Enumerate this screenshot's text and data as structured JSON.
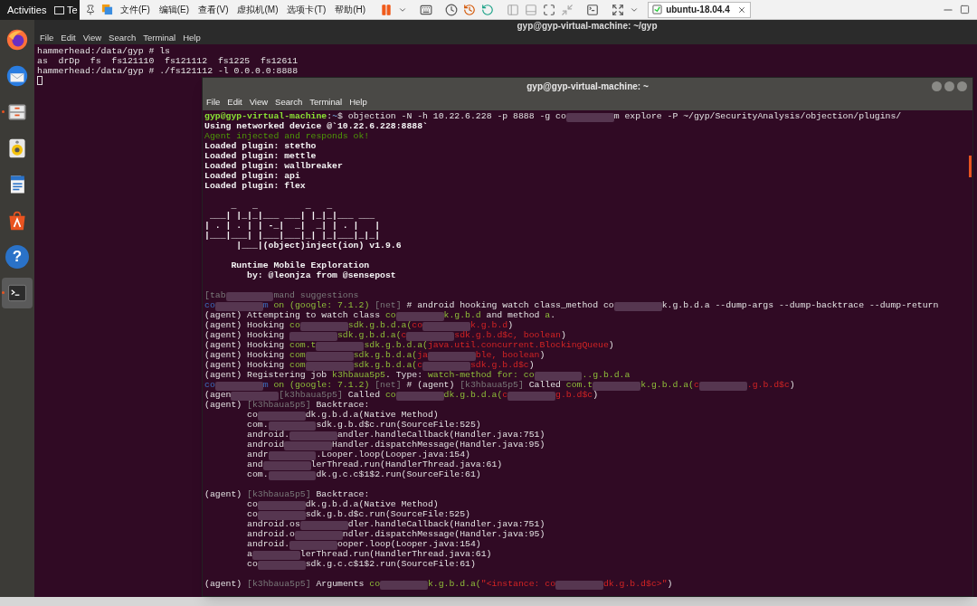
{
  "top_bar": {
    "activities": "Activities",
    "window_label": "Te"
  },
  "vm_toolbar": {
    "menu": [
      "文件(F)",
      "编辑(E)",
      "查看(V)",
      "虚拟机(M)",
      "选项卡(T)",
      "帮助(H)"
    ],
    "tab": {
      "label": "ubuntu-18.04.4",
      "selected": true
    }
  },
  "dock": {
    "items": [
      {
        "kind": "browser",
        "running": false
      },
      {
        "kind": "mail",
        "running": false
      },
      {
        "kind": "files",
        "running": true
      },
      {
        "kind": "music",
        "running": false
      },
      {
        "kind": "writer",
        "running": false
      },
      {
        "kind": "software",
        "running": false
      },
      {
        "kind": "help",
        "glyph": "?",
        "running": false
      },
      {
        "kind": "terminal",
        "running": true,
        "selected": true
      }
    ]
  },
  "back_terminal": {
    "title": "gyp@gyp-virtual-machine: ~/gyp",
    "menu": [
      "File",
      "Edit",
      "View",
      "Search",
      "Terminal",
      "Help"
    ],
    "lines": [
      "hammerhead:/data/gyp # ls",
      "as  drDp  fs  fs121110  fs121112  fs1225  fs12611",
      "hammerhead:/data/gyp # ./fs121112 -l 0.0.0.0:8888"
    ]
  },
  "front_terminal": {
    "title": "gyp@gyp-virtual-machine: ~",
    "menu": [
      "File",
      "Edit",
      "View",
      "Search",
      "Terminal",
      "Help"
    ],
    "lines": [
      {
        "kind": "text",
        "spans": [
          {
            "kind": "prompt",
            "text": "gyp@gyp-virtual-machine"
          },
          {
            "kind": "plain",
            "text": ":"
          },
          {
            "kind": "path",
            "text": "~"
          },
          {
            "kind": "plain",
            "text": "$ objection -N -h 10.22.6.228 -p 8888 -g co"
          },
          {
            "kind": "redacted"
          },
          {
            "kind": "plain",
            "text": "m explore -P ~/gyp/SecurityAnalysis/objection/plugins/"
          }
        ]
      },
      {
        "kind": "text",
        "spans": [
          {
            "kind": "bold",
            "text": "Using networked device @`10.22.6.228:8888`"
          }
        ]
      },
      {
        "kind": "text",
        "spans": [
          {
            "kind": "dim",
            "text": "Agent injected and responds ok!"
          }
        ]
      },
      {
        "kind": "text",
        "spans": [
          {
            "kind": "bold",
            "text": "Loaded plugin: stetho"
          }
        ]
      },
      {
        "kind": "text",
        "spans": [
          {
            "kind": "bold",
            "text": "Loaded plugin: mettle"
          }
        ]
      },
      {
        "kind": "text",
        "spans": [
          {
            "kind": "bold",
            "text": "Loaded plugin: wallbreaker"
          }
        ]
      },
      {
        "kind": "text",
        "spans": [
          {
            "kind": "bold",
            "text": "Loaded plugin: api"
          }
        ]
      },
      {
        "kind": "text",
        "spans": [
          {
            "kind": "bold",
            "text": "Loaded plugin: flex"
          }
        ]
      },
      {
        "kind": "blank"
      },
      {
        "kind": "text",
        "spans": [
          {
            "kind": "bold",
            "text": "     _   _         _   _"
          }
        ]
      },
      {
        "kind": "text",
        "spans": [
          {
            "kind": "bold",
            "text": " ___| |_|_|___ ___| |_|_|___ ___"
          }
        ]
      },
      {
        "kind": "text",
        "spans": [
          {
            "kind": "bold",
            "text": "| . | . | | -_|  _|  _| | . |   |"
          }
        ]
      },
      {
        "kind": "text",
        "spans": [
          {
            "kind": "bold",
            "text": "|___|___| |___|___|_| |_|___|_|_|"
          }
        ]
      },
      {
        "kind": "text",
        "spans": [
          {
            "kind": "bold",
            "text": "      |___|(object)inject(ion) v1.9.6"
          }
        ]
      },
      {
        "kind": "blank"
      },
      {
        "kind": "text",
        "spans": [
          {
            "kind": "bold",
            "text": "     Runtime Mobile Exploration"
          }
        ]
      },
      {
        "kind": "text",
        "spans": [
          {
            "kind": "bold",
            "text": "        by: @leonjza from @sensepost"
          }
        ]
      },
      {
        "kind": "blank"
      },
      {
        "kind": "text",
        "spans": [
          {
            "kind": "grey",
            "text": "[tab"
          },
          {
            "kind": "redacted"
          },
          {
            "kind": "grey",
            "text": "mand suggestions"
          }
        ]
      },
      {
        "kind": "text",
        "spans": [
          {
            "kind": "host",
            "text": "co"
          },
          {
            "kind": "redacted"
          },
          {
            "kind": "host",
            "text": "m"
          },
          {
            "kind": "green",
            "text": " on (google: 7.1.2) "
          },
          {
            "kind": "grey",
            "text": "[net]"
          },
          {
            "kind": "plain",
            "text": " # android hooking watch class_method co"
          },
          {
            "kind": "redacted"
          },
          {
            "kind": "plain",
            "text": "k.g.b.d.a --dump-args --dump-backtrace --dump-return"
          }
        ]
      },
      {
        "kind": "text",
        "spans": [
          {
            "kind": "plain",
            "text": "(agent) Attempting to watch class "
          },
          {
            "kind": "green",
            "text": "co"
          },
          {
            "kind": "redacted"
          },
          {
            "kind": "green",
            "text": "k.g.b.d"
          },
          {
            "kind": "plain",
            "text": " and method "
          },
          {
            "kind": "green",
            "text": "a"
          },
          {
            "kind": "plain",
            "text": "."
          }
        ]
      },
      {
        "kind": "text",
        "spans": [
          {
            "kind": "plain",
            "text": "(agent) Hooking "
          },
          {
            "kind": "green",
            "text": "co"
          },
          {
            "kind": "redacted"
          },
          {
            "kind": "green",
            "text": "sdk.g.b.d.a("
          },
          {
            "kind": "red",
            "text": "co"
          },
          {
            "kind": "redacted"
          },
          {
            "kind": "red",
            "text": "k.g.b.d"
          },
          {
            "kind": "plain",
            "text": ")"
          }
        ]
      },
      {
        "kind": "text",
        "spans": [
          {
            "kind": "plain",
            "text": "(agent) Hooking "
          },
          {
            "kind": "redacted"
          },
          {
            "kind": "green",
            "text": "sdk.g.b.d.a("
          },
          {
            "kind": "red",
            "text": "c"
          },
          {
            "kind": "redacted"
          },
          {
            "kind": "red",
            "text": "sdk.g.b.d$c, boolean"
          },
          {
            "kind": "plain",
            "text": ")"
          }
        ]
      },
      {
        "kind": "text",
        "spans": [
          {
            "kind": "plain",
            "text": "(agent) Hooking "
          },
          {
            "kind": "green",
            "text": "com.t"
          },
          {
            "kind": "redacted"
          },
          {
            "kind": "green",
            "text": "sdk.g.b.d.a("
          },
          {
            "kind": "red",
            "text": "java.util.concurrent.BlockingQueue"
          },
          {
            "kind": "plain",
            "text": ")"
          }
        ]
      },
      {
        "kind": "text",
        "spans": [
          {
            "kind": "plain",
            "text": "(agent) Hooking "
          },
          {
            "kind": "green",
            "text": "com"
          },
          {
            "kind": "redacted"
          },
          {
            "kind": "green",
            "text": "sdk.g.b.d.a("
          },
          {
            "kind": "red",
            "text": "ja"
          },
          {
            "kind": "redacted"
          },
          {
            "kind": "red",
            "text": "ble, boolean"
          },
          {
            "kind": "plain",
            "text": ")"
          }
        ]
      },
      {
        "kind": "text",
        "spans": [
          {
            "kind": "plain",
            "text": "(agent) Hooking "
          },
          {
            "kind": "green",
            "text": "com"
          },
          {
            "kind": "redacted"
          },
          {
            "kind": "green",
            "text": "sdk.g.b.d.a("
          },
          {
            "kind": "red",
            "text": "c"
          },
          {
            "kind": "redacted"
          },
          {
            "kind": "red",
            "text": "sdk.g.b.d$c"
          },
          {
            "kind": "plain",
            "text": ")"
          }
        ]
      },
      {
        "kind": "text",
        "spans": [
          {
            "kind": "plain",
            "text": "(agent) Registering job "
          },
          {
            "kind": "green",
            "text": "k3hbaua5p5"
          },
          {
            "kind": "plain",
            "text": ". Type: "
          },
          {
            "kind": "green",
            "text": "watch-method for: co"
          },
          {
            "kind": "redacted"
          },
          {
            "kind": "green",
            "text": "..g.b.d.a"
          }
        ]
      },
      {
        "kind": "text",
        "spans": [
          {
            "kind": "host",
            "text": "co"
          },
          {
            "kind": "redacted"
          },
          {
            "kind": "host",
            "text": "m"
          },
          {
            "kind": "green",
            "text": " on (google: 7.1.2) "
          },
          {
            "kind": "grey",
            "text": "[net]"
          },
          {
            "kind": "plain",
            "text": " # (agent) "
          },
          {
            "kind": "grey",
            "text": "[k3hbaua5p5]"
          },
          {
            "kind": "plain",
            "text": " Called "
          },
          {
            "kind": "green",
            "text": "com.t"
          },
          {
            "kind": "redacted"
          },
          {
            "kind": "green",
            "text": "k.g.b.d.a("
          },
          {
            "kind": "red",
            "text": "c"
          },
          {
            "kind": "redacted"
          },
          {
            "kind": "red",
            "text": ".g.b.d$c"
          },
          {
            "kind": "plain",
            "text": ")"
          }
        ]
      },
      {
        "kind": "text",
        "spans": [
          {
            "kind": "plain",
            "text": "(agen"
          },
          {
            "kind": "redacted"
          },
          {
            "kind": "grey",
            "text": "[k3hbaua5p5]"
          },
          {
            "kind": "plain",
            "text": " Called "
          },
          {
            "kind": "green",
            "text": "co"
          },
          {
            "kind": "redacted"
          },
          {
            "kind": "green",
            "text": "dk.g.b.d.a("
          },
          {
            "kind": "red",
            "text": "c"
          },
          {
            "kind": "redacted"
          },
          {
            "kind": "red",
            "text": "g.b.d$c"
          },
          {
            "kind": "plain",
            "text": ")"
          }
        ]
      },
      {
        "kind": "text",
        "spans": [
          {
            "kind": "plain",
            "text": "(agent) "
          },
          {
            "kind": "grey",
            "text": "[k3hbaua5p5]"
          },
          {
            "kind": "plain",
            "text": " Backtrace:"
          }
        ]
      },
      {
        "kind": "text",
        "spans": [
          {
            "kind": "plain",
            "text": "        co"
          },
          {
            "kind": "redacted"
          },
          {
            "kind": "plain",
            "text": "dk.g.b.d.a(Native Method)"
          }
        ]
      },
      {
        "kind": "text",
        "spans": [
          {
            "kind": "plain",
            "text": "        com."
          },
          {
            "kind": "redacted"
          },
          {
            "kind": "plain",
            "text": "sdk.g.b.d$c.run(SourceFile:525)"
          }
        ]
      },
      {
        "kind": "text",
        "spans": [
          {
            "kind": "plain",
            "text": "        android."
          },
          {
            "kind": "redacted"
          },
          {
            "kind": "plain",
            "text": "andler.handleCallback(Handler.java:751)"
          }
        ]
      },
      {
        "kind": "text",
        "spans": [
          {
            "kind": "plain",
            "text": "        android"
          },
          {
            "kind": "redacted"
          },
          {
            "kind": "plain",
            "text": "Handler.dispatchMessage(Handler.java:95)"
          }
        ]
      },
      {
        "kind": "text",
        "spans": [
          {
            "kind": "plain",
            "text": "        andr"
          },
          {
            "kind": "redacted"
          },
          {
            "kind": "plain",
            "text": ".Looper.loop(Looper.java:154)"
          }
        ]
      },
      {
        "kind": "text",
        "spans": [
          {
            "kind": "plain",
            "text": "        and"
          },
          {
            "kind": "redacted"
          },
          {
            "kind": "plain",
            "text": "lerThread.run(HandlerThread.java:61)"
          }
        ]
      },
      {
        "kind": "text",
        "spans": [
          {
            "kind": "plain",
            "text": "        com."
          },
          {
            "kind": "redacted"
          },
          {
            "kind": "plain",
            "text": "dk.g.c.c$1$2.run(SourceFile:61)"
          }
        ]
      },
      {
        "kind": "blank"
      },
      {
        "kind": "text",
        "spans": [
          {
            "kind": "plain",
            "text": "(agent) "
          },
          {
            "kind": "grey",
            "text": "[k3hbaua5p5]"
          },
          {
            "kind": "plain",
            "text": " Backtrace:"
          }
        ]
      },
      {
        "kind": "text",
        "spans": [
          {
            "kind": "plain",
            "text": "        co"
          },
          {
            "kind": "redacted"
          },
          {
            "kind": "plain",
            "text": "dk.g.b.d.a(Native Method)"
          }
        ]
      },
      {
        "kind": "text",
        "spans": [
          {
            "kind": "plain",
            "text": "        co"
          },
          {
            "kind": "redacted"
          },
          {
            "kind": "plain",
            "text": "sdk.g.b.d$c.run(SourceFile:525)"
          }
        ]
      },
      {
        "kind": "text",
        "spans": [
          {
            "kind": "plain",
            "text": "        android.os"
          },
          {
            "kind": "redacted"
          },
          {
            "kind": "plain",
            "text": "dler.handleCallback(Handler.java:751)"
          }
        ]
      },
      {
        "kind": "text",
        "spans": [
          {
            "kind": "plain",
            "text": "        android.o"
          },
          {
            "kind": "redacted"
          },
          {
            "kind": "plain",
            "text": "ndler.dispatchMessage(Handler.java:95)"
          }
        ]
      },
      {
        "kind": "text",
        "spans": [
          {
            "kind": "plain",
            "text": "        android."
          },
          {
            "kind": "redacted"
          },
          {
            "kind": "plain",
            "text": "ooper.loop(Looper.java:154)"
          }
        ]
      },
      {
        "kind": "text",
        "spans": [
          {
            "kind": "plain",
            "text": "        a"
          },
          {
            "kind": "redacted"
          },
          {
            "kind": "plain",
            "text": "lerThread.run(HandlerThread.java:61)"
          }
        ]
      },
      {
        "kind": "text",
        "spans": [
          {
            "kind": "plain",
            "text": "        co"
          },
          {
            "kind": "redacted"
          },
          {
            "kind": "plain",
            "text": "sdk.g.c.c$1$2.run(SourceFile:61)"
          }
        ]
      },
      {
        "kind": "blank"
      },
      {
        "kind": "text",
        "spans": [
          {
            "kind": "plain",
            "text": "(agent) "
          },
          {
            "kind": "grey",
            "text": "[k3hbaua5p5]"
          },
          {
            "kind": "plain",
            "text": " Arguments "
          },
          {
            "kind": "green",
            "text": "co"
          },
          {
            "kind": "redacted"
          },
          {
            "kind": "green",
            "text": "k.g.b.d.a("
          },
          {
            "kind": "red",
            "text": "\"<instance: co"
          },
          {
            "kind": "redacted"
          },
          {
            "kind": "red",
            "text": "dk.g.b.d$c>\""
          },
          {
            "kind": "plain",
            "text": ")"
          }
        ]
      }
    ]
  }
}
